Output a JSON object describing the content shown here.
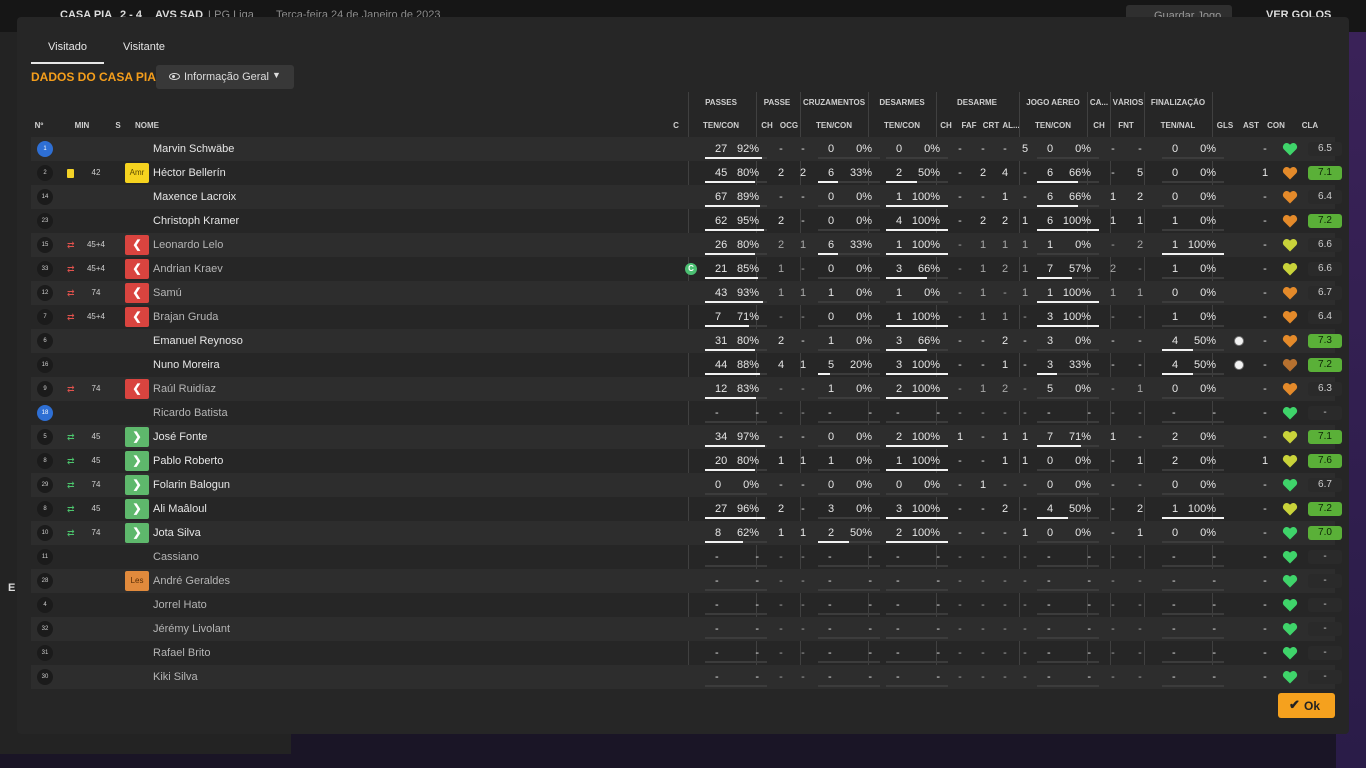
{
  "background": {
    "match_home": "CASA PIA",
    "match_score": "2 - 4",
    "match_away": "AVS SAD",
    "competition": "LPG Liga",
    "date": "Terça-feira 24 de Janeiro de 2023",
    "save_label": "Guardar Jogo",
    "next_label": "VER GOLOS",
    "side_letter": "E"
  },
  "tabs": [
    {
      "label": "Visitado",
      "active": true
    },
    {
      "label": "Visitante",
      "active": false
    }
  ],
  "section_title": "DADOS DO CASA PIA",
  "dropdown_label": "Informação Geral",
  "headers": {
    "groups": [
      "PASSES",
      "PASSE",
      "CRUZAMENTOS",
      "DESARMES",
      "DESARME",
      "JOGO AÉREO",
      "CA...",
      "VÁRIOS",
      "FINALIZAÇÃO"
    ],
    "cols": [
      "Nº",
      "MIN",
      "S",
      "NOME",
      "C",
      "TEN/CON",
      "CH",
      "OCG",
      "TEN/CON",
      "TEN/CON",
      "CH",
      "FAF",
      "CRT",
      "AL...",
      "TEN/CON",
      "CH",
      "FNT",
      "TEN/NAL",
      "GLS",
      "AST",
      "CON",
      "CLA"
    ]
  },
  "colors": {
    "accent": "#f59e1b",
    "rating_good": "#5ab038",
    "sub_out": "#d9443f",
    "sub_in": "#5eb86c"
  },
  "players": [
    {
      "no": "1",
      "gk": true,
      "card": false,
      "arrow": "",
      "min": "",
      "badge": "",
      "name": "Marvin Schwäbe",
      "dim": false,
      "captain": false,
      "p": [
        "27",
        "92%"
      ],
      "pf": 0.92,
      "pch": "-",
      "pocg": "-",
      "cr": [
        "0",
        "0%"
      ],
      "crf": 0,
      "ds": [
        "0",
        "0%"
      ],
      "dsf": 0,
      "dch": "-",
      "faf": "-",
      "crt": "-",
      "al": "5",
      "ja": [
        "0",
        "0%"
      ],
      "jaf": 0,
      "cach": "-",
      "fnt": "-",
      "fin": [
        "0",
        "0%"
      ],
      "finf": 0,
      "gls": "",
      "ast": "-",
      "con": "green",
      "cla": "6.5",
      "good": false
    },
    {
      "no": "2",
      "gk": false,
      "card": true,
      "arrow": "",
      "min": "42",
      "badge": "Amr",
      "name": "Héctor Bellerín",
      "dim": false,
      "captain": false,
      "p": [
        "45",
        "80%"
      ],
      "pf": 0.8,
      "pch": "2",
      "pocg": "2",
      "cr": [
        "6",
        "33%"
      ],
      "crf": 0.33,
      "ds": [
        "2",
        "50%"
      ],
      "dsf": 0.5,
      "dch": "-",
      "faf": "2",
      "crt": "4",
      "al": "-",
      "ja": [
        "6",
        "66%"
      ],
      "jaf": 0.66,
      "cach": "-",
      "fnt": "5",
      "fin": [
        "0",
        "0%"
      ],
      "finf": 0,
      "gls": "",
      "ast": "1",
      "con": "orange",
      "cla": "7.1",
      "good": true
    },
    {
      "no": "14",
      "gk": false,
      "card": false,
      "arrow": "",
      "min": "",
      "badge": "",
      "name": "Maxence Lacroix",
      "dim": false,
      "captain": false,
      "p": [
        "67",
        "89%"
      ],
      "pf": 0.89,
      "pch": "-",
      "pocg": "-",
      "cr": [
        "0",
        "0%"
      ],
      "crf": 0,
      "ds": [
        "1",
        "100%"
      ],
      "dsf": 1,
      "dch": "-",
      "faf": "-",
      "crt": "1",
      "al": "-",
      "ja": [
        "6",
        "66%"
      ],
      "jaf": 0.66,
      "cach": "1",
      "fnt": "2",
      "fin": [
        "0",
        "0%"
      ],
      "finf": 0,
      "gls": "",
      "ast": "-",
      "con": "orange",
      "cla": "6.4",
      "good": false
    },
    {
      "no": "23",
      "gk": false,
      "card": false,
      "arrow": "",
      "min": "",
      "badge": "",
      "name": "Christoph Kramer",
      "dim": false,
      "captain": false,
      "p": [
        "62",
        "95%"
      ],
      "pf": 0.95,
      "pch": "2",
      "pocg": "-",
      "cr": [
        "0",
        "0%"
      ],
      "crf": 0,
      "ds": [
        "4",
        "100%"
      ],
      "dsf": 1,
      "dch": "-",
      "faf": "2",
      "crt": "2",
      "al": "1",
      "ja": [
        "6",
        "100%"
      ],
      "jaf": 1,
      "cach": "1",
      "fnt": "1",
      "fin": [
        "1",
        "0%"
      ],
      "finf": 0,
      "gls": "",
      "ast": "-",
      "con": "orange",
      "cla": "7.2",
      "good": true
    },
    {
      "no": "15",
      "gk": false,
      "card": false,
      "arrow": "out",
      "min": "45+4",
      "badge": "red",
      "name": "Leonardo Lelo",
      "dim": true,
      "captain": false,
      "p": [
        "26",
        "80%"
      ],
      "pf": 0.8,
      "pch": "2",
      "pocg": "1",
      "cr": [
        "6",
        "33%"
      ],
      "crf": 0.33,
      "ds": [
        "1",
        "100%"
      ],
      "dsf": 1,
      "dch": "-",
      "faf": "1",
      "crt": "1",
      "al": "1",
      "ja": [
        "1",
        "0%"
      ],
      "jaf": 0,
      "cach": "-",
      "fnt": "2",
      "fin": [
        "1",
        "100%"
      ],
      "finf": 1,
      "gls": "",
      "ast": "-",
      "con": "yellow",
      "cla": "6.6",
      "good": false
    },
    {
      "no": "33",
      "gk": false,
      "card": false,
      "arrow": "out",
      "min": "45+4",
      "badge": "red",
      "name": "Andrian Kraev",
      "dim": true,
      "captain": true,
      "p": [
        "21",
        "85%"
      ],
      "pf": 0.85,
      "pch": "1",
      "pocg": "-",
      "cr": [
        "0",
        "0%"
      ],
      "crf": 0,
      "ds": [
        "3",
        "66%"
      ],
      "dsf": 0.66,
      "dch": "-",
      "faf": "1",
      "crt": "2",
      "al": "1",
      "ja": [
        "7",
        "57%"
      ],
      "jaf": 0.57,
      "cach": "2",
      "fnt": "-",
      "fin": [
        "1",
        "0%"
      ],
      "finf": 0,
      "gls": "",
      "ast": "-",
      "con": "yellow",
      "cla": "6.6",
      "good": false
    },
    {
      "no": "12",
      "gk": false,
      "card": false,
      "arrow": "out",
      "min": "74",
      "badge": "red",
      "name": "Samú",
      "dim": true,
      "captain": false,
      "p": [
        "43",
        "93%"
      ],
      "pf": 0.93,
      "pch": "1",
      "pocg": "1",
      "cr": [
        "1",
        "0%"
      ],
      "crf": 0,
      "ds": [
        "1",
        "0%"
      ],
      "dsf": 0,
      "dch": "-",
      "faf": "1",
      "crt": "-",
      "al": "1",
      "ja": [
        "1",
        "100%"
      ],
      "jaf": 1,
      "cach": "1",
      "fnt": "1",
      "fin": [
        "0",
        "0%"
      ],
      "finf": 0,
      "gls": "",
      "ast": "-",
      "con": "orange",
      "cla": "6.7",
      "good": false
    },
    {
      "no": "7",
      "gk": false,
      "card": false,
      "arrow": "out",
      "min": "45+4",
      "badge": "red",
      "name": "Brajan Gruda",
      "dim": true,
      "captain": false,
      "p": [
        "7",
        "71%"
      ],
      "pf": 0.71,
      "pch": "-",
      "pocg": "-",
      "cr": [
        "0",
        "0%"
      ],
      "crf": 0,
      "ds": [
        "1",
        "100%"
      ],
      "dsf": 1,
      "dch": "-",
      "faf": "1",
      "crt": "1",
      "al": "-",
      "ja": [
        "3",
        "100%"
      ],
      "jaf": 1,
      "cach": "-",
      "fnt": "-",
      "fin": [
        "1",
        "0%"
      ],
      "finf": 0,
      "gls": "",
      "ast": "-",
      "con": "orange",
      "cla": "6.4",
      "good": false
    },
    {
      "no": "6",
      "gk": false,
      "card": false,
      "arrow": "",
      "min": "",
      "badge": "",
      "name": "Emanuel Reynoso",
      "dim": false,
      "captain": false,
      "p": [
        "31",
        "80%"
      ],
      "pf": 0.8,
      "pch": "2",
      "pocg": "-",
      "cr": [
        "1",
        "0%"
      ],
      "crf": 0,
      "ds": [
        "3",
        "66%"
      ],
      "dsf": 0.66,
      "dch": "-",
      "faf": "-",
      "crt": "2",
      "al": "-",
      "ja": [
        "3",
        "0%"
      ],
      "jaf": 0,
      "cach": "-",
      "fnt": "-",
      "fin": [
        "4",
        "50%"
      ],
      "finf": 0.5,
      "gls": "ball",
      "ast": "-",
      "con": "orange",
      "cla": "7.3",
      "good": true
    },
    {
      "no": "16",
      "gk": false,
      "card": false,
      "arrow": "",
      "min": "",
      "badge": "",
      "name": "Nuno Moreira",
      "dim": false,
      "captain": false,
      "p": [
        "44",
        "88%"
      ],
      "pf": 0.88,
      "pch": "4",
      "pocg": "1",
      "cr": [
        "5",
        "20%"
      ],
      "crf": 0.2,
      "ds": [
        "3",
        "100%"
      ],
      "dsf": 1,
      "dch": "-",
      "faf": "-",
      "crt": "1",
      "al": "-",
      "ja": [
        "3",
        "33%"
      ],
      "jaf": 0.33,
      "cach": "-",
      "fnt": "-",
      "fin": [
        "4",
        "50%"
      ],
      "finf": 0.5,
      "gls": "ball",
      "ast": "-",
      "con": "brown",
      "cla": "7.2",
      "good": true
    },
    {
      "no": "9",
      "gk": false,
      "card": false,
      "arrow": "out",
      "min": "74",
      "badge": "red",
      "name": "Raúl Ruidíaz",
      "dim": true,
      "captain": false,
      "p": [
        "12",
        "83%"
      ],
      "pf": 0.83,
      "pch": "-",
      "pocg": "-",
      "cr": [
        "1",
        "0%"
      ],
      "crf": 0,
      "ds": [
        "2",
        "100%"
      ],
      "dsf": 1,
      "dch": "-",
      "faf": "1",
      "crt": "2",
      "al": "-",
      "ja": [
        "5",
        "0%"
      ],
      "jaf": 0,
      "cach": "-",
      "fnt": "1",
      "fin": [
        "0",
        "0%"
      ],
      "finf": 0,
      "gls": "",
      "ast": "-",
      "con": "orange",
      "cla": "6.3",
      "good": false
    },
    {
      "no": "18",
      "gk": true,
      "card": false,
      "arrow": "",
      "min": "",
      "badge": "",
      "name": "Ricardo Batista",
      "dim": true,
      "captain": false,
      "p": [
        "-",
        "-"
      ],
      "pf": 0,
      "pch": "-",
      "pocg": "-",
      "cr": [
        "-",
        "-"
      ],
      "crf": 0,
      "ds": [
        "-",
        "-"
      ],
      "dsf": 0,
      "dch": "-",
      "faf": "-",
      "crt": "-",
      "al": "-",
      "ja": [
        "-",
        "-"
      ],
      "jaf": 0,
      "cach": "-",
      "fnt": "-",
      "fin": [
        "-",
        "-"
      ],
      "finf": 0,
      "gls": "",
      "ast": "-",
      "con": "green",
      "cla": "-",
      "good": false
    },
    {
      "no": "5",
      "gk": false,
      "card": false,
      "arrow": "in",
      "min": "45",
      "badge": "green",
      "name": "José Fonte",
      "dim": false,
      "captain": false,
      "p": [
        "34",
        "97%"
      ],
      "pf": 0.97,
      "pch": "-",
      "pocg": "-",
      "cr": [
        "0",
        "0%"
      ],
      "crf": 0,
      "ds": [
        "2",
        "100%"
      ],
      "dsf": 1,
      "dch": "1",
      "faf": "-",
      "crt": "1",
      "al": "1",
      "ja": [
        "7",
        "71%"
      ],
      "jaf": 0.71,
      "cach": "1",
      "fnt": "-",
      "fin": [
        "2",
        "0%"
      ],
      "finf": 0,
      "gls": "",
      "ast": "-",
      "con": "yellow",
      "cla": "7.1",
      "good": true
    },
    {
      "no": "8",
      "gk": false,
      "card": false,
      "arrow": "in",
      "min": "45",
      "badge": "green",
      "name": "Pablo Roberto",
      "dim": false,
      "captain": false,
      "p": [
        "20",
        "80%"
      ],
      "pf": 0.8,
      "pch": "1",
      "pocg": "1",
      "cr": [
        "1",
        "0%"
      ],
      "crf": 0,
      "ds": [
        "1",
        "100%"
      ],
      "dsf": 1,
      "dch": "-",
      "faf": "-",
      "crt": "1",
      "al": "1",
      "ja": [
        "0",
        "0%"
      ],
      "jaf": 0,
      "cach": "-",
      "fnt": "1",
      "fin": [
        "2",
        "0%"
      ],
      "finf": 0,
      "gls": "",
      "ast": "1",
      "con": "yellow",
      "cla": "7.6",
      "good": true
    },
    {
      "no": "29",
      "gk": false,
      "card": false,
      "arrow": "in",
      "min": "74",
      "badge": "green",
      "name": "Folarin Balogun",
      "dim": false,
      "captain": false,
      "p": [
        "0",
        "0%"
      ],
      "pf": 0,
      "pch": "-",
      "pocg": "-",
      "cr": [
        "0",
        "0%"
      ],
      "crf": 0,
      "ds": [
        "0",
        "0%"
      ],
      "dsf": 0,
      "dch": "-",
      "faf": "1",
      "crt": "-",
      "al": "-",
      "ja": [
        "0",
        "0%"
      ],
      "jaf": 0,
      "cach": "-",
      "fnt": "-",
      "fin": [
        "0",
        "0%"
      ],
      "finf": 0,
      "gls": "",
      "ast": "-",
      "con": "green",
      "cla": "6.7",
      "good": false
    },
    {
      "no": "8",
      "gk": false,
      "card": false,
      "arrow": "in",
      "min": "45",
      "badge": "green",
      "name": "Ali Maâloul",
      "dim": false,
      "captain": false,
      "p": [
        "27",
        "96%"
      ],
      "pf": 0.96,
      "pch": "2",
      "pocg": "-",
      "cr": [
        "3",
        "0%"
      ],
      "crf": 0,
      "ds": [
        "3",
        "100%"
      ],
      "dsf": 1,
      "dch": "-",
      "faf": "-",
      "crt": "2",
      "al": "-",
      "ja": [
        "4",
        "50%"
      ],
      "jaf": 0.5,
      "cach": "-",
      "fnt": "2",
      "fin": [
        "1",
        "100%"
      ],
      "finf": 1,
      "gls": "",
      "ast": "-",
      "con": "yellow",
      "cla": "7.2",
      "good": true
    },
    {
      "no": "10",
      "gk": false,
      "card": false,
      "arrow": "in",
      "min": "74",
      "badge": "green",
      "name": "Jota Silva",
      "dim": false,
      "captain": false,
      "p": [
        "8",
        "62%"
      ],
      "pf": 0.62,
      "pch": "1",
      "pocg": "1",
      "cr": [
        "2",
        "50%"
      ],
      "crf": 0.5,
      "ds": [
        "2",
        "100%"
      ],
      "dsf": 1,
      "dch": "-",
      "faf": "-",
      "crt": "-",
      "al": "1",
      "ja": [
        "0",
        "0%"
      ],
      "jaf": 0,
      "cach": "-",
      "fnt": "1",
      "fin": [
        "0",
        "0%"
      ],
      "finf": 0,
      "gls": "",
      "ast": "-",
      "con": "green",
      "cla": "7.0",
      "good": true
    },
    {
      "no": "11",
      "gk": false,
      "card": false,
      "arrow": "",
      "min": "",
      "badge": "",
      "name": "Cassiano",
      "dim": true,
      "captain": false,
      "p": [
        "-",
        "-"
      ],
      "pf": 0,
      "pch": "-",
      "pocg": "-",
      "cr": [
        "-",
        "-"
      ],
      "crf": 0,
      "ds": [
        "-",
        "-"
      ],
      "dsf": 0,
      "dch": "-",
      "faf": "-",
      "crt": "-",
      "al": "-",
      "ja": [
        "-",
        "-"
      ],
      "jaf": 0,
      "cach": "-",
      "fnt": "-",
      "fin": [
        "-",
        "-"
      ],
      "finf": 0,
      "gls": "",
      "ast": "-",
      "con": "green",
      "cla": "-",
      "good": false
    },
    {
      "no": "28",
      "gk": false,
      "card": false,
      "arrow": "",
      "min": "",
      "badge": "Les",
      "name": "André Geraldes",
      "dim": true,
      "captain": false,
      "p": [
        "-",
        "-"
      ],
      "pf": 0,
      "pch": "-",
      "pocg": "-",
      "cr": [
        "-",
        "-"
      ],
      "crf": 0,
      "ds": [
        "-",
        "-"
      ],
      "dsf": 0,
      "dch": "-",
      "faf": "-",
      "crt": "-",
      "al": "-",
      "ja": [
        "-",
        "-"
      ],
      "jaf": 0,
      "cach": "-",
      "fnt": "-",
      "fin": [
        "-",
        "-"
      ],
      "finf": 0,
      "gls": "",
      "ast": "-",
      "con": "green",
      "cla": "-",
      "good": false
    },
    {
      "no": "4",
      "gk": false,
      "card": false,
      "arrow": "",
      "min": "",
      "badge": "",
      "name": "Jorrel Hato",
      "dim": true,
      "captain": false,
      "p": [
        "-",
        "-"
      ],
      "pf": 0,
      "pch": "-",
      "pocg": "-",
      "cr": [
        "-",
        "-"
      ],
      "crf": 0,
      "ds": [
        "-",
        "-"
      ],
      "dsf": 0,
      "dch": "-",
      "faf": "-",
      "crt": "-",
      "al": "-",
      "ja": [
        "-",
        "-"
      ],
      "jaf": 0,
      "cach": "-",
      "fnt": "-",
      "fin": [
        "-",
        "-"
      ],
      "finf": 0,
      "gls": "",
      "ast": "-",
      "con": "green",
      "cla": "-",
      "good": false
    },
    {
      "no": "32",
      "gk": false,
      "card": false,
      "arrow": "",
      "min": "",
      "badge": "",
      "name": "Jérémy Livolant",
      "dim": true,
      "captain": false,
      "p": [
        "-",
        "-"
      ],
      "pf": 0,
      "pch": "-",
      "pocg": "-",
      "cr": [
        "-",
        "-"
      ],
      "crf": 0,
      "ds": [
        "-",
        "-"
      ],
      "dsf": 0,
      "dch": "-",
      "faf": "-",
      "crt": "-",
      "al": "-",
      "ja": [
        "-",
        "-"
      ],
      "jaf": 0,
      "cach": "-",
      "fnt": "-",
      "fin": [
        "-",
        "-"
      ],
      "finf": 0,
      "gls": "",
      "ast": "-",
      "con": "green",
      "cla": "-",
      "good": false
    },
    {
      "no": "31",
      "gk": false,
      "card": false,
      "arrow": "",
      "min": "",
      "badge": "",
      "name": "Rafael Brito",
      "dim": true,
      "captain": false,
      "p": [
        "-",
        "-"
      ],
      "pf": 0,
      "pch": "-",
      "pocg": "-",
      "cr": [
        "-",
        "-"
      ],
      "crf": 0,
      "ds": [
        "-",
        "-"
      ],
      "dsf": 0,
      "dch": "-",
      "faf": "-",
      "crt": "-",
      "al": "-",
      "ja": [
        "-",
        "-"
      ],
      "jaf": 0,
      "cach": "-",
      "fnt": "-",
      "fin": [
        "-",
        "-"
      ],
      "finf": 0,
      "gls": "",
      "ast": "-",
      "con": "green",
      "cla": "-",
      "good": false
    },
    {
      "no": "30",
      "gk": false,
      "card": false,
      "arrow": "",
      "min": "",
      "badge": "",
      "name": "Kiki Silva",
      "dim": true,
      "captain": false,
      "p": [
        "-",
        "-"
      ],
      "pf": 0,
      "pch": "-",
      "pocg": "-",
      "cr": [
        "-",
        "-"
      ],
      "crf": 0,
      "ds": [
        "-",
        "-"
      ],
      "dsf": 0,
      "dch": "-",
      "faf": "-",
      "crt": "-",
      "al": "-",
      "ja": [
        "-",
        "-"
      ],
      "jaf": 0,
      "cach": "-",
      "fnt": "-",
      "fin": [
        "-",
        "-"
      ],
      "finf": 0,
      "gls": "",
      "ast": "-",
      "con": "green",
      "cla": "-",
      "good": false
    }
  ],
  "ok_label": "Ok"
}
